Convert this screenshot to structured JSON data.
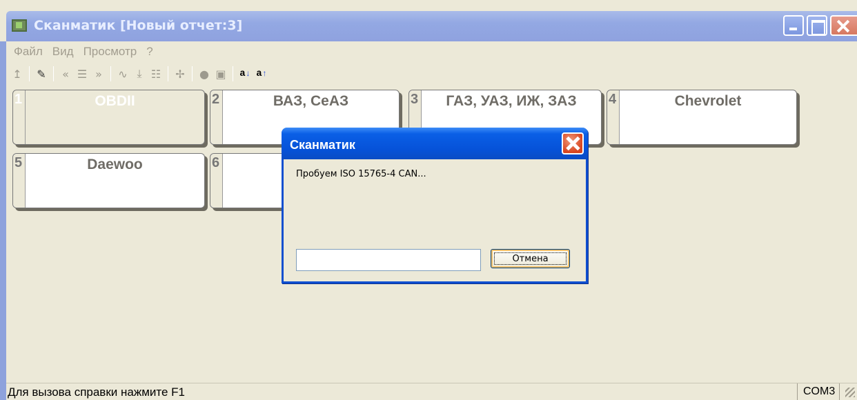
{
  "window": {
    "title": "Сканматик [Новый отчет:3]"
  },
  "menu": {
    "items": [
      "Файл",
      "Вид",
      "Просмотр",
      "?"
    ]
  },
  "toolbar": {
    "sort_asc_label": "a",
    "sort_desc_label": "a"
  },
  "tiles": [
    {
      "number": "1",
      "label": "OBDII"
    },
    {
      "number": "2",
      "label": "ВАЗ, СеАЗ"
    },
    {
      "number": "3",
      "label": "ГАЗ, УАЗ, ИЖ, ЗАЗ"
    },
    {
      "number": "4",
      "label": "Chevrolet"
    },
    {
      "number": "5",
      "label": "Daewoo"
    },
    {
      "number": "6",
      "label": ""
    }
  ],
  "dialog": {
    "title": "Сканматик",
    "message": "Пробуем ISO 15765-4 CAN...",
    "input_value": "",
    "cancel_label": "Отмена"
  },
  "status": {
    "hint": "Для вызова справки нажмите F1",
    "port": "COM3"
  },
  "colors": {
    "dialog_titlebar": "#0652d8",
    "window_titlebar_inactive": "#93a8e3",
    "background": "#ece9d8"
  }
}
